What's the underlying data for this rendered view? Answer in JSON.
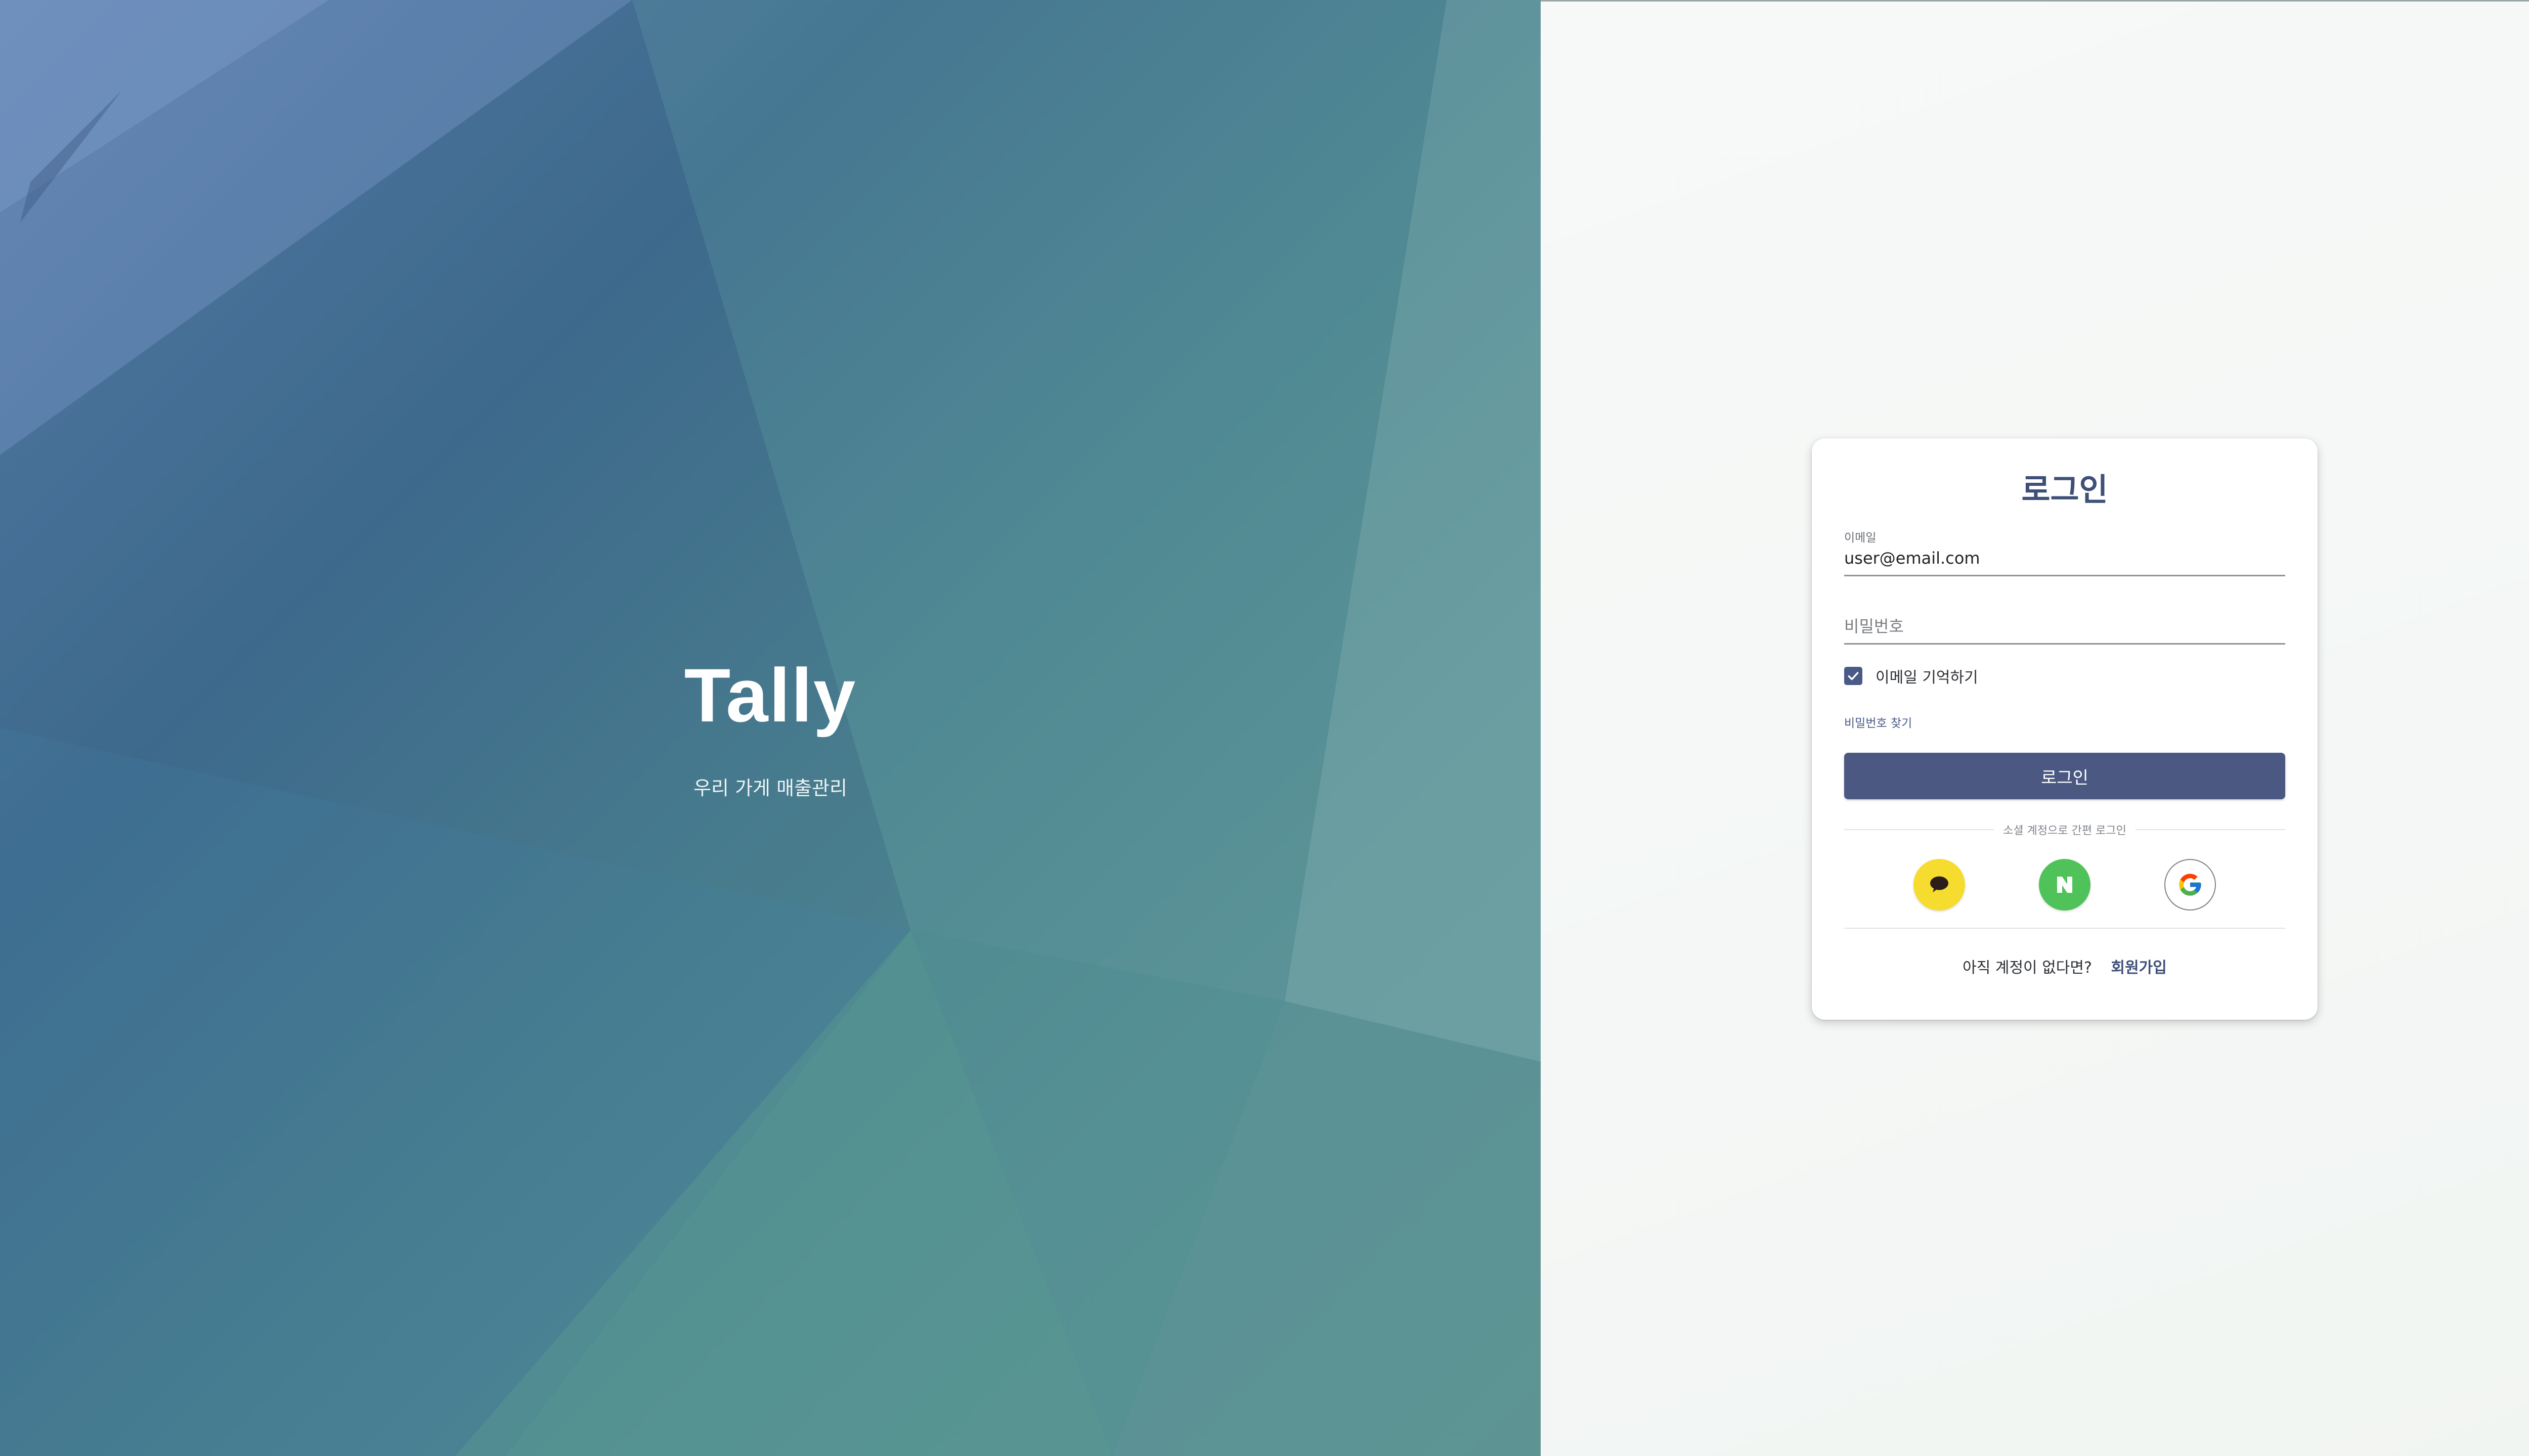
{
  "hero": {
    "title": "Tally",
    "subtitle": "우리 가게 매출관리"
  },
  "login": {
    "title": "로그인",
    "email_label": "이메일",
    "email_value": "user@email.com",
    "password_placeholder": "비밀번호",
    "remember_label": "이메일 기억하기",
    "remember_checked": true,
    "forgot_password": "비밀번호 찾기",
    "submit_label": "로그인",
    "social_divider": "소셜 계정으로 간편 로그인",
    "social_buttons": [
      {
        "name": "kakao",
        "icon": "kakao-talk-icon",
        "color": "#f6dc2f"
      },
      {
        "name": "naver",
        "icon": "naver-n-icon",
        "color": "#4fc25a"
      },
      {
        "name": "google",
        "icon": "google-g-icon",
        "color": "#ffffff"
      }
    ],
    "signup_prompt": "아직 계정이 없다면?",
    "signup_link": "회원가입"
  },
  "colors": {
    "accent": "#4a5882",
    "title": "#3e4f78",
    "hero_background": "#4d8590"
  }
}
